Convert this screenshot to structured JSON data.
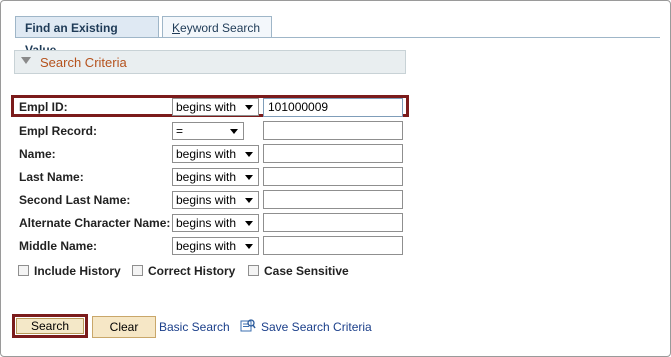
{
  "tabs": [
    {
      "label": "Find an Existing Value"
    },
    {
      "label_underlined": "K",
      "label_rest": "eyword Search"
    }
  ],
  "criteria": {
    "label": "Search Criteria"
  },
  "fields": [
    {
      "label": "Empl ID:",
      "operator": "begins with",
      "value": "101000009"
    },
    {
      "label": "Empl Record:",
      "operator": "=",
      "value": ""
    },
    {
      "label": "Name:",
      "operator": "begins with",
      "value": ""
    },
    {
      "label": "Last Name:",
      "operator": "begins with",
      "value": ""
    },
    {
      "label": "Second Last Name:",
      "operator": "begins with",
      "value": ""
    },
    {
      "label": "Alternate Character Name:",
      "operator": "begins with",
      "value": ""
    },
    {
      "label": "Middle Name:",
      "operator": "begins with",
      "value": ""
    }
  ],
  "options": [
    {
      "label": "Include History",
      "checked": false
    },
    {
      "label": "Correct History",
      "checked": false
    },
    {
      "label": "Case Sensitive",
      "checked": false
    }
  ],
  "actions": {
    "search": "Search",
    "clear": "Clear",
    "basic_search": "Basic Search",
    "save_search": "Save Search Criteria"
  },
  "colors": {
    "highlight": "#7b1b1b",
    "criteria_text": "#b5521d",
    "link": "#1b3f8a"
  }
}
